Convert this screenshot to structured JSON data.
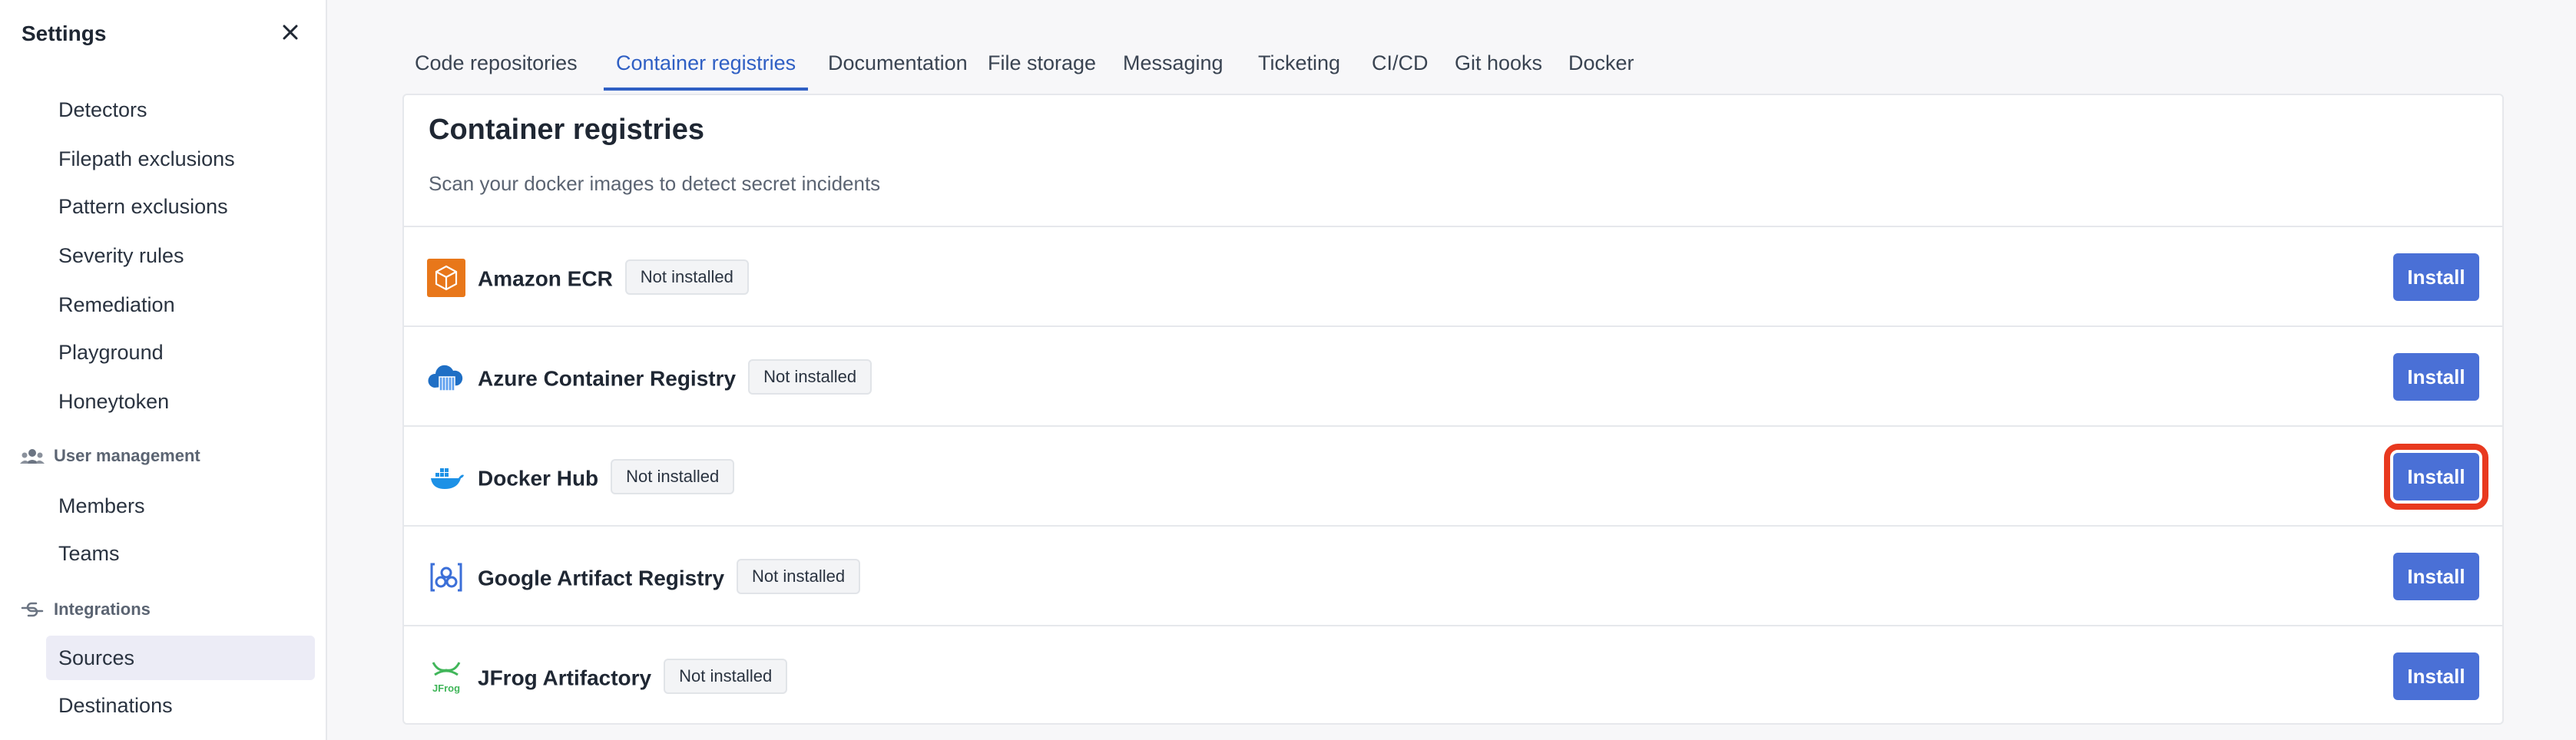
{
  "sidebar": {
    "title": "Settings",
    "close_icon": "close-icon",
    "items_top": [
      {
        "label": "Detectors"
      },
      {
        "label": "Filepath exclusions"
      },
      {
        "label": "Pattern exclusions"
      },
      {
        "label": "Severity rules"
      },
      {
        "label": "Remediation"
      },
      {
        "label": "Playground"
      },
      {
        "label": "Honeytoken"
      }
    ],
    "section_user": {
      "label": "User management",
      "icon": "users-icon"
    },
    "items_user": [
      {
        "label": "Members"
      },
      {
        "label": "Teams"
      }
    ],
    "section_integrations": {
      "label": "Integrations",
      "icon": "integrations-icon"
    },
    "items_integrations": [
      {
        "label": "Sources",
        "active": true
      },
      {
        "label": "Destinations"
      }
    ]
  },
  "tabs": [
    {
      "label": "Code repositories"
    },
    {
      "label": "Container registries",
      "active": true
    },
    {
      "label": "Documentation"
    },
    {
      "label": "File storage"
    },
    {
      "label": "Messaging"
    },
    {
      "label": "Ticketing"
    },
    {
      "label": "CI/CD"
    },
    {
      "label": "Git hooks"
    },
    {
      "label": "Docker"
    }
  ],
  "main": {
    "title": "Container registries",
    "subtitle": "Scan your docker images to detect secret incidents",
    "rows": [
      {
        "name": "Amazon ECR",
        "status": "Not installed",
        "button": "Install",
        "icon": "amazon-ecr-icon"
      },
      {
        "name": "Azure Container Registry",
        "status": "Not installed",
        "button": "Install",
        "icon": "azure-container-registry-icon"
      },
      {
        "name": "Docker Hub",
        "status": "Not installed",
        "button": "Install",
        "icon": "docker-hub-icon",
        "highlighted": true
      },
      {
        "name": "Google Artifact Registry",
        "status": "Not installed",
        "button": "Install",
        "icon": "google-artifact-registry-icon"
      },
      {
        "name": "JFrog Artifactory",
        "status": "Not installed",
        "button": "Install",
        "icon": "jfrog-artifactory-icon"
      }
    ]
  },
  "colors": {
    "accent": "#2f5fc4",
    "button": "#4a70d6",
    "highlight": "#e8391f",
    "active_bg": "#ececf6"
  }
}
